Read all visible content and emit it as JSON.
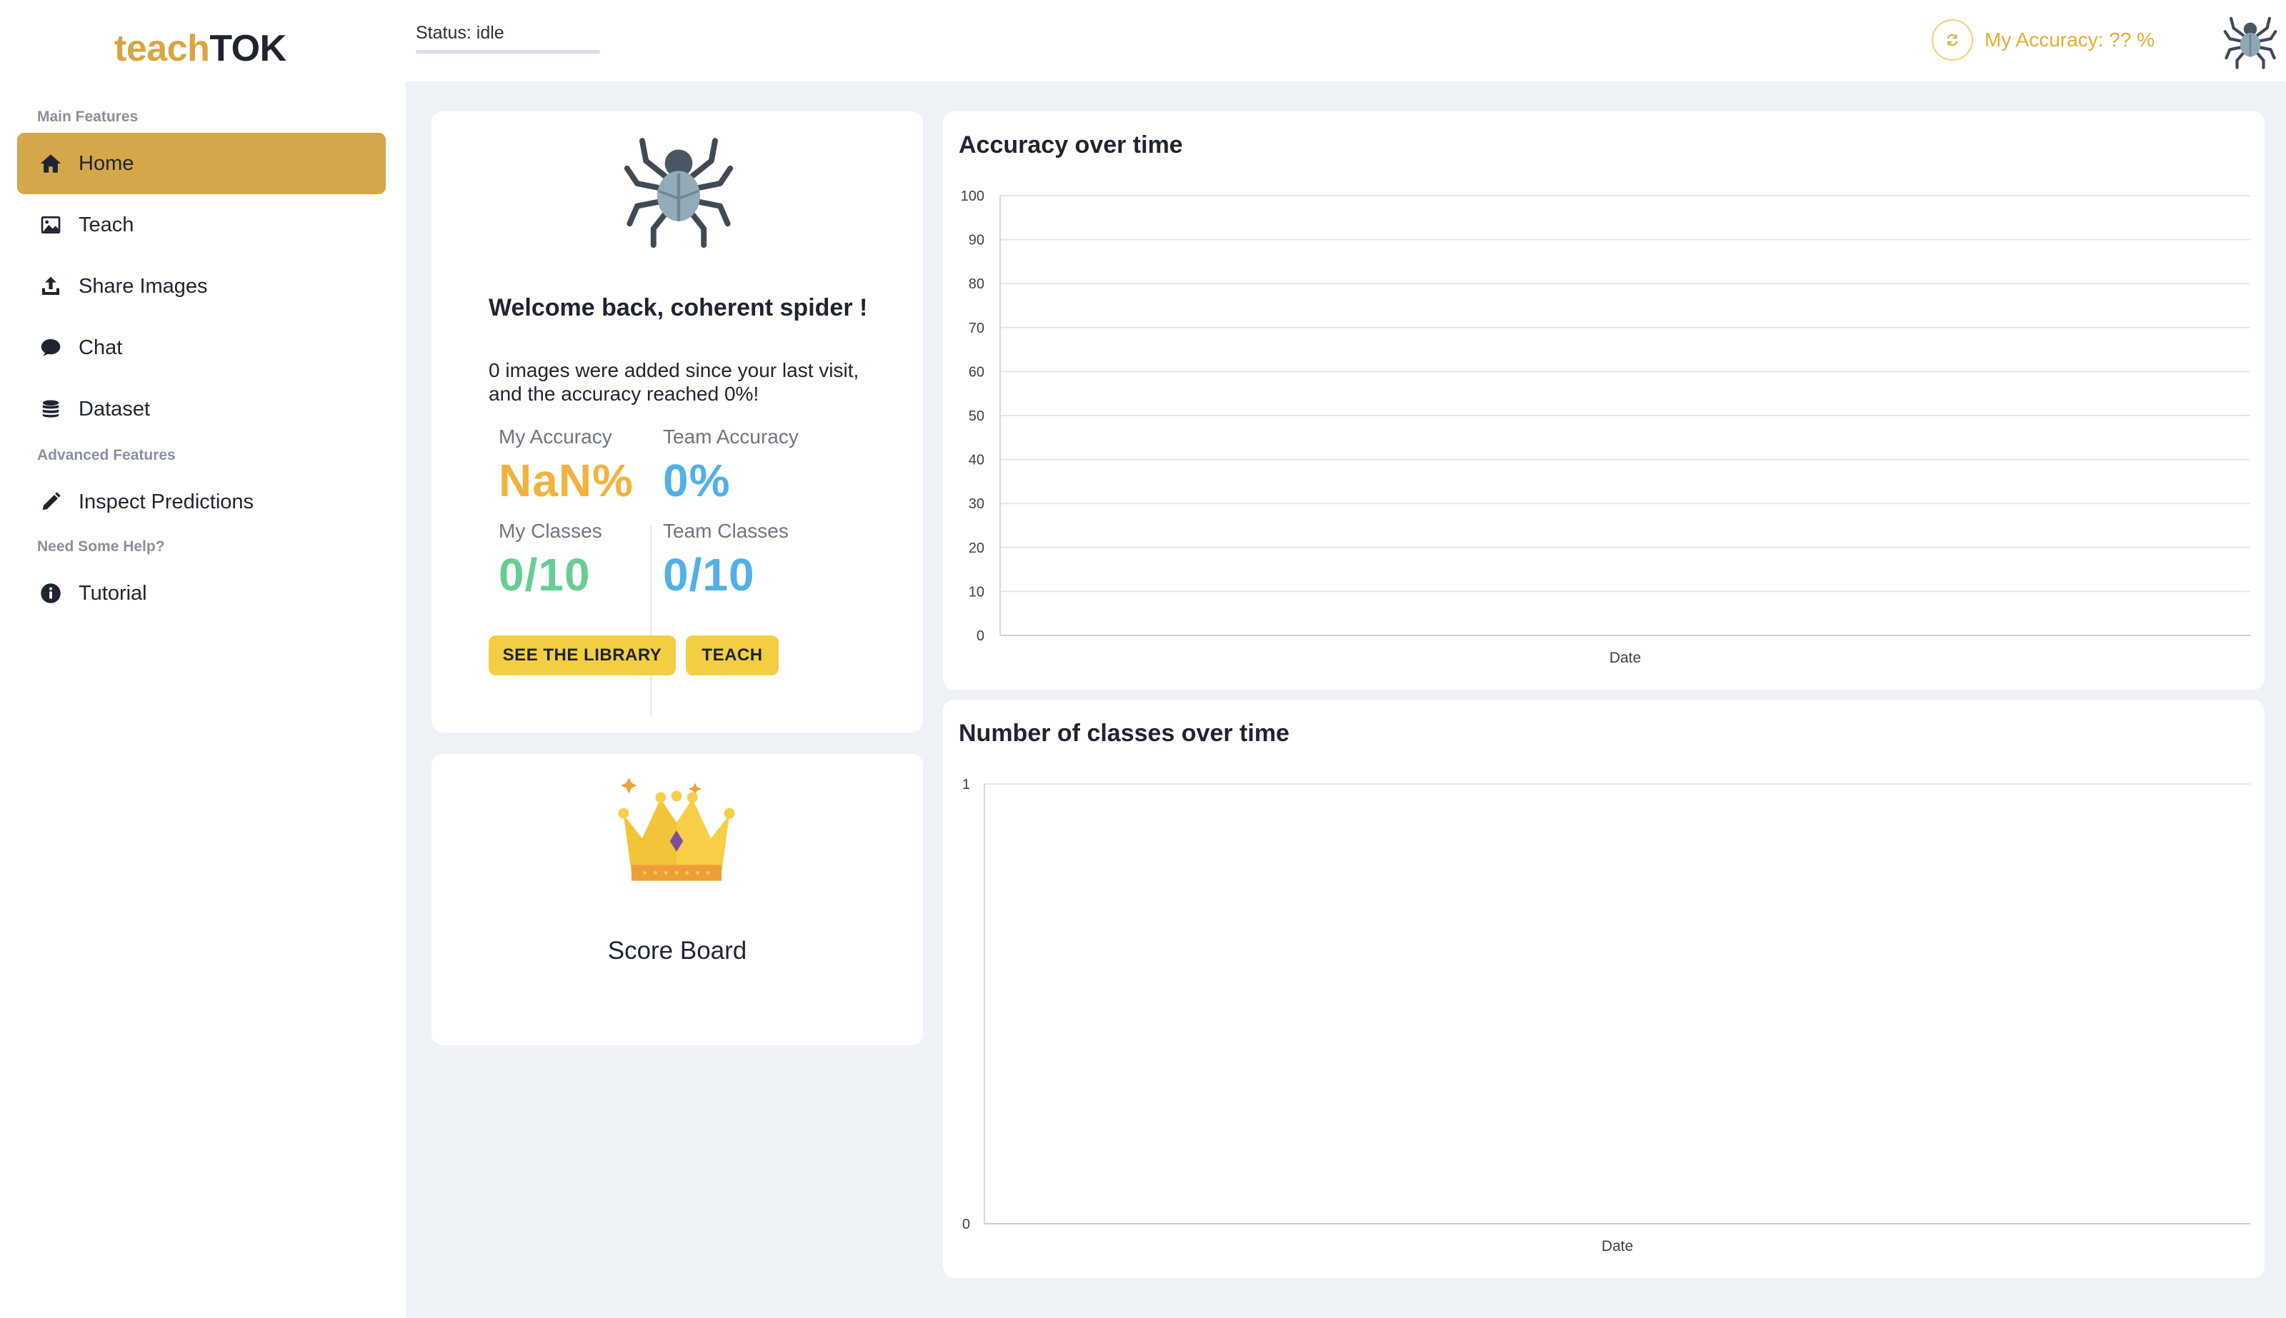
{
  "brand": {
    "part1": "teach",
    "part2": "TOK"
  },
  "sidebar": {
    "sections": [
      {
        "title": "Main Features"
      },
      {
        "title": "Advanced Features"
      },
      {
        "title": "Need Some Help?"
      }
    ],
    "items": [
      {
        "label": "Home",
        "icon": "home-icon"
      },
      {
        "label": "Teach",
        "icon": "image-icon"
      },
      {
        "label": "Share Images",
        "icon": "upload-icon"
      },
      {
        "label": "Chat",
        "icon": "chat-bubble-icon"
      },
      {
        "label": "Dataset",
        "icon": "database-icon"
      },
      {
        "label": "Inspect Predictions",
        "icon": "pencil-icon"
      },
      {
        "label": "Tutorial",
        "icon": "info-icon"
      }
    ],
    "active_index": 0
  },
  "topbar": {
    "status": "Status: idle",
    "accuracy_label": "My Accuracy: ?? %",
    "refresh_icon": "refresh-icon",
    "avatar_icon": "spider-icon"
  },
  "welcome": {
    "avatar_icon": "spider-icon",
    "title": "Welcome back, coherent spider !",
    "text": "0 images were added since your last visit, and the accuracy reached 0%!",
    "stats": {
      "my_accuracy_label": "My Accuracy",
      "my_accuracy_value": "NaN%",
      "team_accuracy_label": "Team Accuracy",
      "team_accuracy_value": "0%",
      "my_classes_label": "My Classes",
      "my_classes_value": "0/10",
      "team_classes_label": "Team Classes",
      "team_classes_value": "0/10"
    },
    "buttons": {
      "library": "SEE THE LIBRARY",
      "teach": "TEACH"
    }
  },
  "scoreboard": {
    "icon": "crown-icon",
    "title": "Score Board"
  },
  "colors": {
    "accent": "#d4a74a",
    "orange": "#f2b33d",
    "blue": "#52b0e8",
    "green": "#68cc96",
    "button": "#f2cf42"
  },
  "chart_data": [
    {
      "type": "line",
      "title": "Accuracy over time",
      "xlabel": "Date",
      "ylabel": "",
      "ylim": [
        0,
        100
      ],
      "yticks": [
        0,
        10,
        20,
        30,
        40,
        50,
        60,
        70,
        80,
        90,
        100
      ],
      "x": [],
      "series": [],
      "grid": true
    },
    {
      "type": "line",
      "title": "Number of classes over time",
      "xlabel": "Date",
      "ylabel": "",
      "ylim": [
        0,
        1
      ],
      "yticks": [
        0,
        1
      ],
      "x": [],
      "series": [],
      "grid": true
    }
  ]
}
